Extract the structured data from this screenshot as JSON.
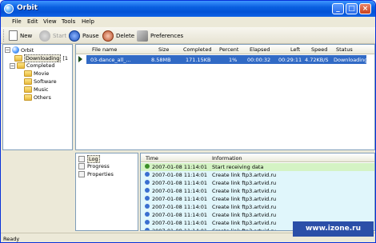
{
  "window": {
    "title": "Orbit",
    "minimize": "_",
    "maximize": "□",
    "close": "×"
  },
  "menu": [
    "File",
    "Edit",
    "View",
    "Tools",
    "Help"
  ],
  "toolbar": {
    "new": "New",
    "start": "Start",
    "pause": "Pause",
    "delete": "Delete",
    "preferences": "Preferences"
  },
  "tree": {
    "root": "Orbit",
    "downloading": "Downloading",
    "downloading_count": "[1",
    "completed": "Completed",
    "movie": "Movie",
    "software": "Software",
    "music": "Music",
    "others": "Others"
  },
  "list": {
    "columns": [
      "File name",
      "Size",
      "Completed",
      "Percent",
      "Elapsed",
      "Left",
      "Speed",
      "Status"
    ],
    "row": {
      "name": "03-dance_all_...",
      "size": "8.58MB",
      "completed": "171.15KB",
      "percent": "1%",
      "elapsed": "00:00:32",
      "left": "00:29:11",
      "speed": "4.72KB/S",
      "status": "Downloading"
    }
  },
  "views": {
    "log": "Log",
    "progress": "Progress",
    "properties": "Properties"
  },
  "log": {
    "columns": [
      "Time",
      "Information"
    ],
    "rows": [
      {
        "time": "2007-01-08 11:14:01",
        "info": "Start receiving data"
      },
      {
        "time": "2007-01-08 11:14:01",
        "info": "Create link ftp3.artvid.ru"
      },
      {
        "time": "2007-01-08 11:14:01",
        "info": "Create link ftp3.artvid.ru"
      },
      {
        "time": "2007-01-08 11:14:01",
        "info": "Create link ftp3.artvid.ru"
      },
      {
        "time": "2007-01-08 11:14:01",
        "info": "Create link ftp3.artvid.ru"
      },
      {
        "time": "2007-01-08 11:14:01",
        "info": "Create link ftp3.artvid.ru"
      },
      {
        "time": "2007-01-08 11:14:01",
        "info": "Create link ftp3.artvid.ru"
      },
      {
        "time": "2007-01-08 11:14:01",
        "info": "Create link ftp3.artvid.ru"
      },
      {
        "time": "2007-01-08 11:14:01",
        "info": "Create link ftp3.artvid.ru"
      }
    ]
  },
  "status": "Ready",
  "watermark": "www.izone.ru",
  "colors": {
    "selection": "#316ac5",
    "log_first_row": "#d4f3c4",
    "log_row": "#e0f6fb"
  }
}
